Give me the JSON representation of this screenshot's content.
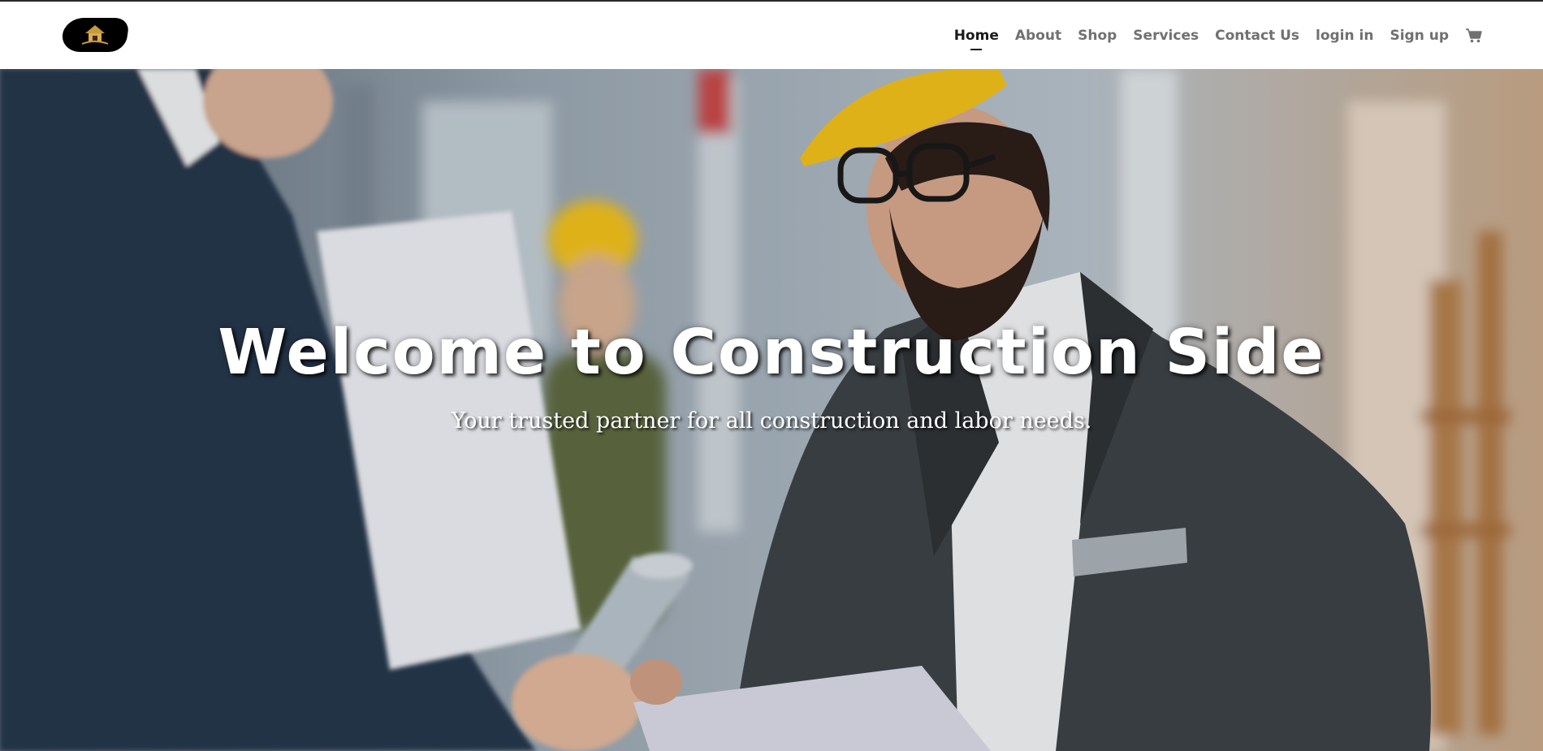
{
  "logo": {
    "icon": "construction-house-logo"
  },
  "nav": {
    "items": [
      {
        "label": "Home",
        "active": true
      },
      {
        "label": "About"
      },
      {
        "label": "Shop"
      },
      {
        "label": "Services"
      },
      {
        "label": "Contact Us"
      },
      {
        "label": "login in"
      },
      {
        "label": "Sign up"
      }
    ],
    "cart_icon": "shopping-cart-icon"
  },
  "hero": {
    "title": "Welcome to Construction Side",
    "subtitle": "Your trusted partner for all construction and labor needs."
  },
  "colors": {
    "nav_text": "#707070",
    "nav_active": "#1a1a1a",
    "hero_text": "#ffffff",
    "hard_hat": "#f2c11c"
  }
}
